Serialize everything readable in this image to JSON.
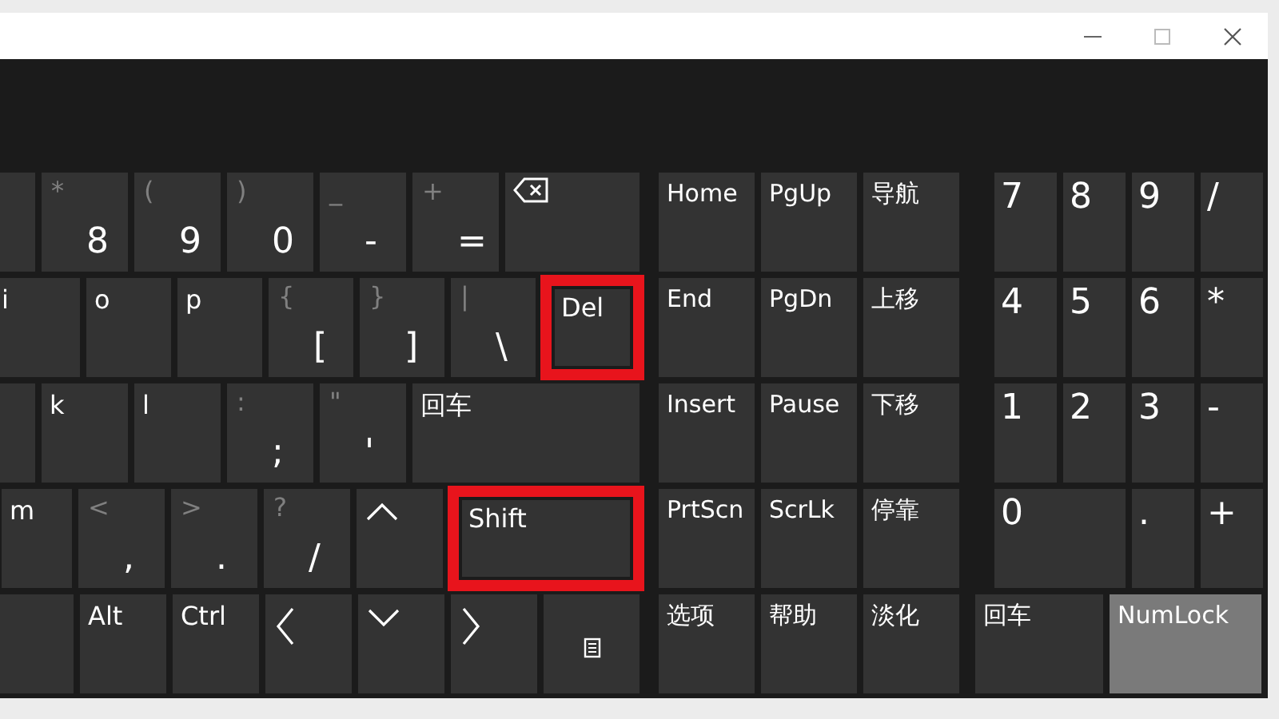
{
  "rows": [
    {
      "main": [
        {
          "kind": "blank",
          "highlighted": false
        },
        {
          "kind": "char",
          "shift": "*",
          "label": "8",
          "highlighted": false
        },
        {
          "kind": "char",
          "shift": "(",
          "label": "9",
          "highlighted": false
        },
        {
          "kind": "char",
          "shift": ")",
          "label": "0",
          "highlighted": false
        },
        {
          "kind": "char",
          "shift": "_",
          "label": "-",
          "highlighted": false
        },
        {
          "kind": "char",
          "shift": "+",
          "label": "=",
          "highlighted": false
        },
        {
          "kind": "backspace",
          "highlighted": false
        }
      ],
      "side": [
        {
          "kind": "char",
          "label": "Home",
          "on": false
        },
        {
          "kind": "char",
          "label": "PgUp",
          "on": false
        },
        {
          "kind": "char",
          "label": "导航",
          "on": false
        },
        {
          "kind": "digit",
          "label": "7",
          "on": false
        },
        {
          "kind": "digit",
          "label": "8",
          "on": false
        },
        {
          "kind": "digit",
          "label": "9",
          "on": false
        },
        {
          "kind": "digit",
          "label": "/",
          "on": false
        }
      ]
    },
    {
      "main": [
        {
          "kind": "char",
          "label": "i",
          "highlighted": false
        },
        {
          "kind": "char",
          "label": "o",
          "highlighted": false
        },
        {
          "kind": "char",
          "label": "p",
          "highlighted": false
        },
        {
          "kind": "char",
          "shift": "{",
          "label": "[",
          "highlighted": false
        },
        {
          "kind": "char",
          "shift": "}",
          "label": "]",
          "highlighted": false
        },
        {
          "kind": "char",
          "shift": "|",
          "label": "\\",
          "highlighted": false
        },
        {
          "kind": "char",
          "label": "Del",
          "highlighted": true
        }
      ],
      "side": [
        {
          "kind": "char",
          "label": "End",
          "on": false
        },
        {
          "kind": "char",
          "label": "PgDn",
          "on": false
        },
        {
          "kind": "char",
          "label": "上移",
          "on": false
        },
        {
          "kind": "digit",
          "label": "4",
          "on": false
        },
        {
          "kind": "digit",
          "label": "5",
          "on": false
        },
        {
          "kind": "digit",
          "label": "6",
          "on": false
        },
        {
          "kind": "digit",
          "label": "*",
          "on": false
        }
      ]
    },
    {
      "main": [
        {
          "kind": "blank",
          "highlighted": false
        },
        {
          "kind": "char",
          "label": "k",
          "highlighted": false
        },
        {
          "kind": "char",
          "label": "l",
          "highlighted": false
        },
        {
          "kind": "char",
          "shift": ":",
          "label": ";",
          "highlighted": false
        },
        {
          "kind": "char",
          "shift": "\"",
          "label": "'",
          "highlighted": false
        },
        {
          "kind": "char",
          "label": "回车",
          "highlighted": false
        }
      ],
      "side": [
        {
          "kind": "char",
          "label": "Insert",
          "on": false
        },
        {
          "kind": "char",
          "label": "Pause",
          "on": false
        },
        {
          "kind": "char",
          "label": "下移",
          "on": false
        },
        {
          "kind": "digit",
          "label": "1",
          "on": false
        },
        {
          "kind": "digit",
          "label": "2",
          "on": false
        },
        {
          "kind": "digit",
          "label": "3",
          "on": false
        },
        {
          "kind": "digit",
          "label": "-",
          "on": false
        }
      ]
    },
    {
      "main": [
        {
          "kind": "char",
          "label": "m",
          "highlighted": false
        },
        {
          "kind": "char",
          "shift": "<",
          "label": ",",
          "highlighted": false
        },
        {
          "kind": "char",
          "shift": ">",
          "label": ".",
          "highlighted": false
        },
        {
          "kind": "char",
          "shift": "?",
          "label": "/",
          "highlighted": false
        },
        {
          "kind": "up",
          "highlighted": false
        },
        {
          "kind": "char",
          "label": "Shift",
          "highlighted": true
        }
      ],
      "side": [
        {
          "kind": "char",
          "label": "PrtScn",
          "on": false
        },
        {
          "kind": "char",
          "label": "ScrLk",
          "on": false
        },
        {
          "kind": "char",
          "label": "停靠",
          "on": false
        },
        {
          "kind": "digit",
          "label": "0",
          "on": false
        },
        {
          "kind": "digit",
          "label": ".",
          "on": false
        },
        {
          "kind": "digit",
          "label": "+",
          "on": false
        }
      ]
    },
    {
      "main": [
        {
          "kind": "blank",
          "highlighted": false
        },
        {
          "kind": "char",
          "label": "Alt",
          "highlighted": false
        },
        {
          "kind": "char",
          "label": "Ctrl",
          "highlighted": false
        },
        {
          "kind": "left",
          "highlighted": false
        },
        {
          "kind": "down",
          "highlighted": false
        },
        {
          "kind": "right",
          "highlighted": false
        },
        {
          "kind": "menu",
          "highlighted": false
        }
      ],
      "side": [
        {
          "kind": "char",
          "label": "选项",
          "on": false
        },
        {
          "kind": "char",
          "label": "帮助",
          "on": false
        },
        {
          "kind": "char",
          "label": "淡化",
          "on": false
        },
        {
          "kind": "char",
          "label": "回车",
          "on": false
        },
        {
          "kind": "char",
          "label": "NumLock",
          "on": true
        }
      ]
    }
  ]
}
